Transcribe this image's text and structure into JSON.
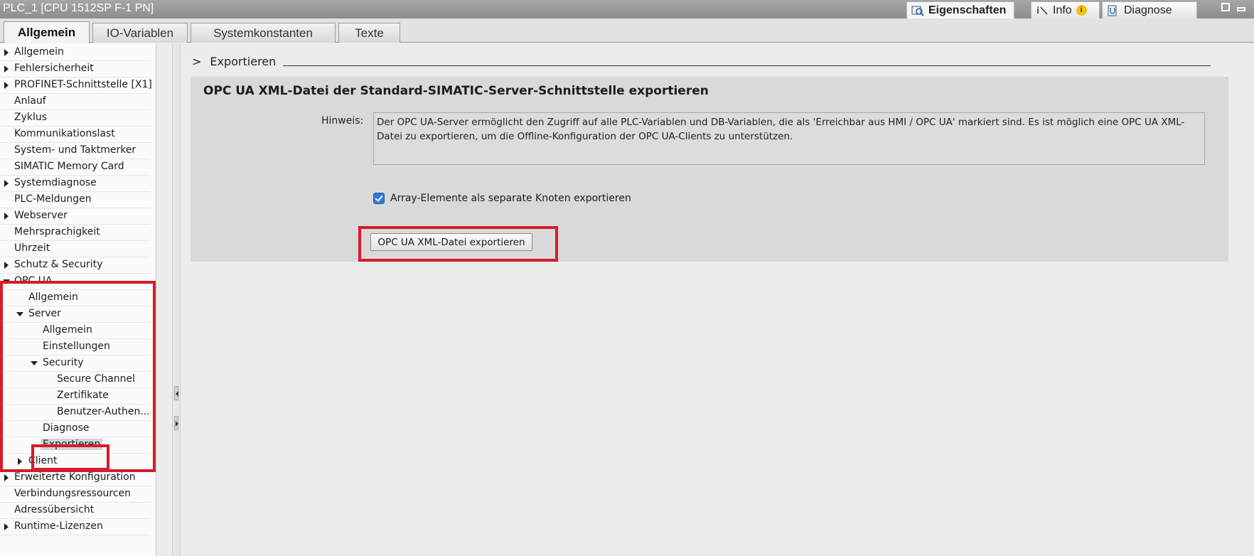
{
  "window": {
    "title": "PLC_1 [CPU 1512SP F-1 PN]"
  },
  "inspector_tabs": [
    {
      "label": "Eigenschaften",
      "icon": "properties-icon",
      "active": true
    },
    {
      "label": "Info",
      "icon": "info-icon",
      "badge_icon": "info-badge-icon"
    },
    {
      "label": "Diagnose",
      "icon": "diagnostics-icon"
    }
  ],
  "tabs": [
    {
      "label": "Allgemein",
      "active": true
    },
    {
      "label": "IO-Variablen"
    },
    {
      "label": "Systemkonstanten"
    },
    {
      "label": "Texte"
    }
  ],
  "nav": {
    "items": [
      {
        "label": "Allgemein",
        "arrow": "right"
      },
      {
        "label": "Fehlersicherheit",
        "arrow": "right",
        "warning": true
      },
      {
        "label": "PROFINET-Schnittstelle [X1]",
        "arrow": "right"
      },
      {
        "label": "Anlauf"
      },
      {
        "label": "Zyklus"
      },
      {
        "label": "Kommunikationslast"
      },
      {
        "label": "System- und Taktmerker"
      },
      {
        "label": "SIMATIC Memory Card"
      },
      {
        "label": "Systemdiagnose",
        "arrow": "right"
      },
      {
        "label": "PLC-Meldungen"
      },
      {
        "label": "Webserver",
        "arrow": "right"
      },
      {
        "label": "Mehrsprachigkeit"
      },
      {
        "label": "Uhrzeit"
      },
      {
        "label": "Schutz & Security",
        "arrow": "right",
        "warning": true
      },
      {
        "label": "OPC UA",
        "arrow": "down"
      },
      {
        "label": "Allgemein"
      },
      {
        "label": "Server",
        "arrow": "down"
      },
      {
        "label": "Allgemein"
      },
      {
        "label": "Einstellungen"
      },
      {
        "label": "Security",
        "arrow": "down"
      },
      {
        "label": "Secure Channel"
      },
      {
        "label": "Zertifikate"
      },
      {
        "label": "Benutzer-Authen..."
      },
      {
        "label": "Diagnose"
      },
      {
        "label": "Exportieren",
        "selected": true
      },
      {
        "label": "Client",
        "arrow": "right"
      },
      {
        "label": "Erweiterte Konfiguration",
        "arrow": "right"
      },
      {
        "label": "Verbindungsressourcen"
      },
      {
        "label": "Adressübersicht"
      },
      {
        "label": "Runtime-Lizenzen",
        "arrow": "right"
      }
    ]
  },
  "content": {
    "breadcrumb_arrow": ">",
    "breadcrumb": "Exportieren",
    "section_title": "OPC UA XML-Datei der Standard-SIMATIC-Server-Schnittstelle exportieren",
    "hint_label": "Hinweis:",
    "hint_text": "Der OPC UA-Server ermöglicht den Zugriff auf alle PLC-Variablen und DB-Variablen, die als 'Erreichbar aus HMI / OPC UA' markiert sind. Es ist möglich eine OPC UA XML-Datei zu exportieren, um die Offline-Konfiguration der OPC UA-Clients zu unterstützen.",
    "checkbox_label": "Array-Elemente als separate Knoten exportieren",
    "checkbox_checked": true,
    "export_button": "OPC UA XML-Datei exportieren"
  },
  "colors": {
    "highlight": "#d61b2a",
    "warning": "#f5e600",
    "checkbox": "#2f7ad6"
  }
}
